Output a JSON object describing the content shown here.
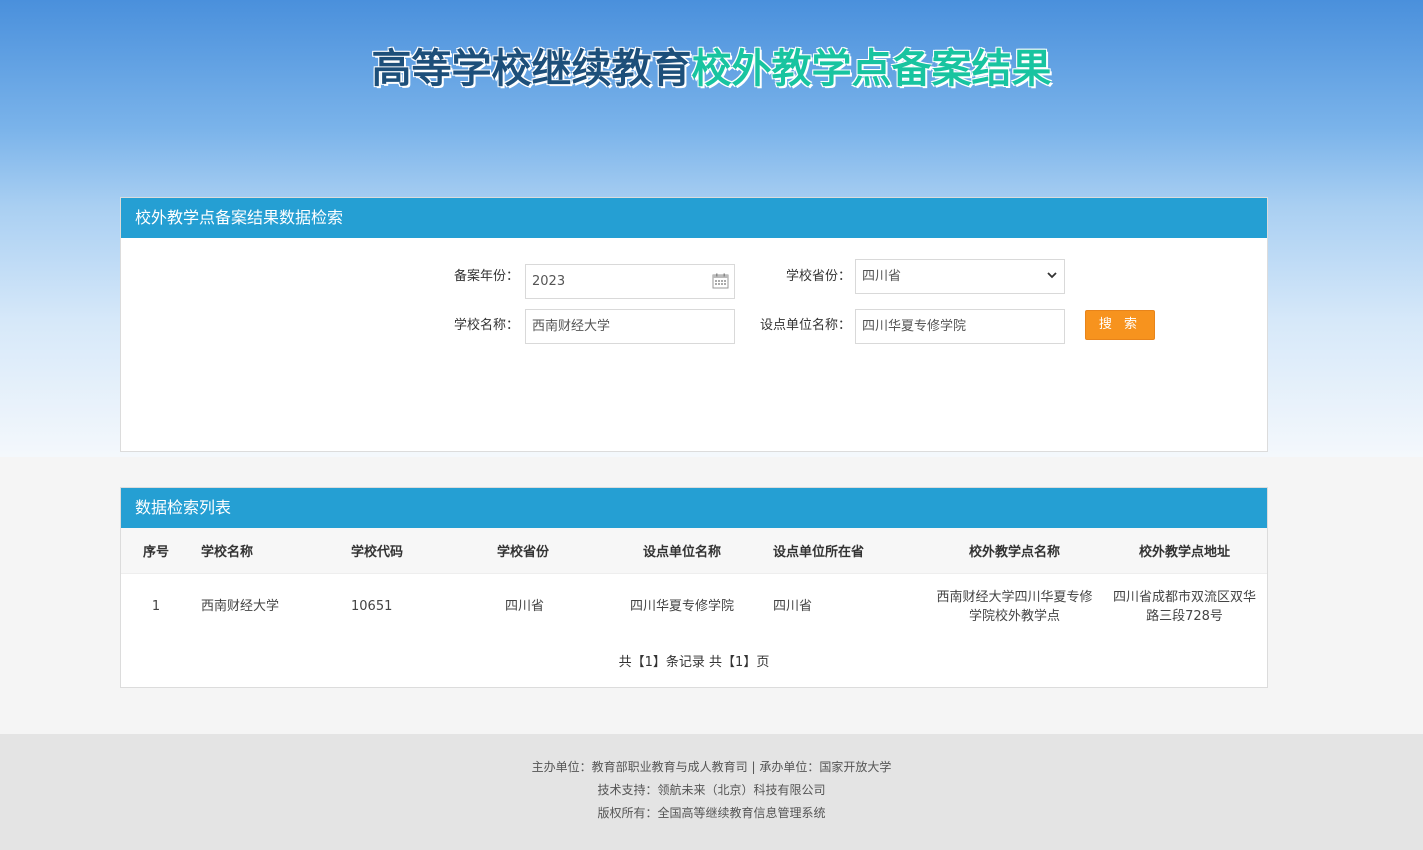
{
  "header": {
    "title_part1": "高等学校继续教育",
    "title_part2": "校外教学点备案结果"
  },
  "search_panel": {
    "heading": "校外教学点备案结果数据检索",
    "year_label": "备案年份：",
    "year_value": "2023",
    "province_label": "学校省份：",
    "province_value": "四川省",
    "school_label": "学校名称：",
    "school_value": "西南财经大学",
    "unit_label": "设点单位名称：",
    "unit_value": "四川华夏专修学院",
    "search_button": "搜 索"
  },
  "list_panel": {
    "heading": "数据检索列表",
    "columns": [
      "序号",
      "学校名称",
      "学校代码",
      "学校省份",
      "设点单位名称",
      "设点单位所在省",
      "校外教学点名称",
      "校外教学点地址"
    ],
    "rows": [
      [
        "1",
        "西南财经大学",
        "10651",
        "四川省",
        "四川华夏专修学院",
        "四川省",
        "西南财经大学四川华夏专修学院校外教学点",
        "四川省成都市双流区双华路三段728号"
      ]
    ],
    "pager": "共【1】条记录 共【1】页"
  },
  "footer": {
    "line1": "主办单位：教育部职业教育与成人教育司 | 承办单位：国家开放大学",
    "line2": "技术支持：领航未来（北京）科技有限公司",
    "line3": "版权所有：全国高等继续教育信息管理系统"
  }
}
